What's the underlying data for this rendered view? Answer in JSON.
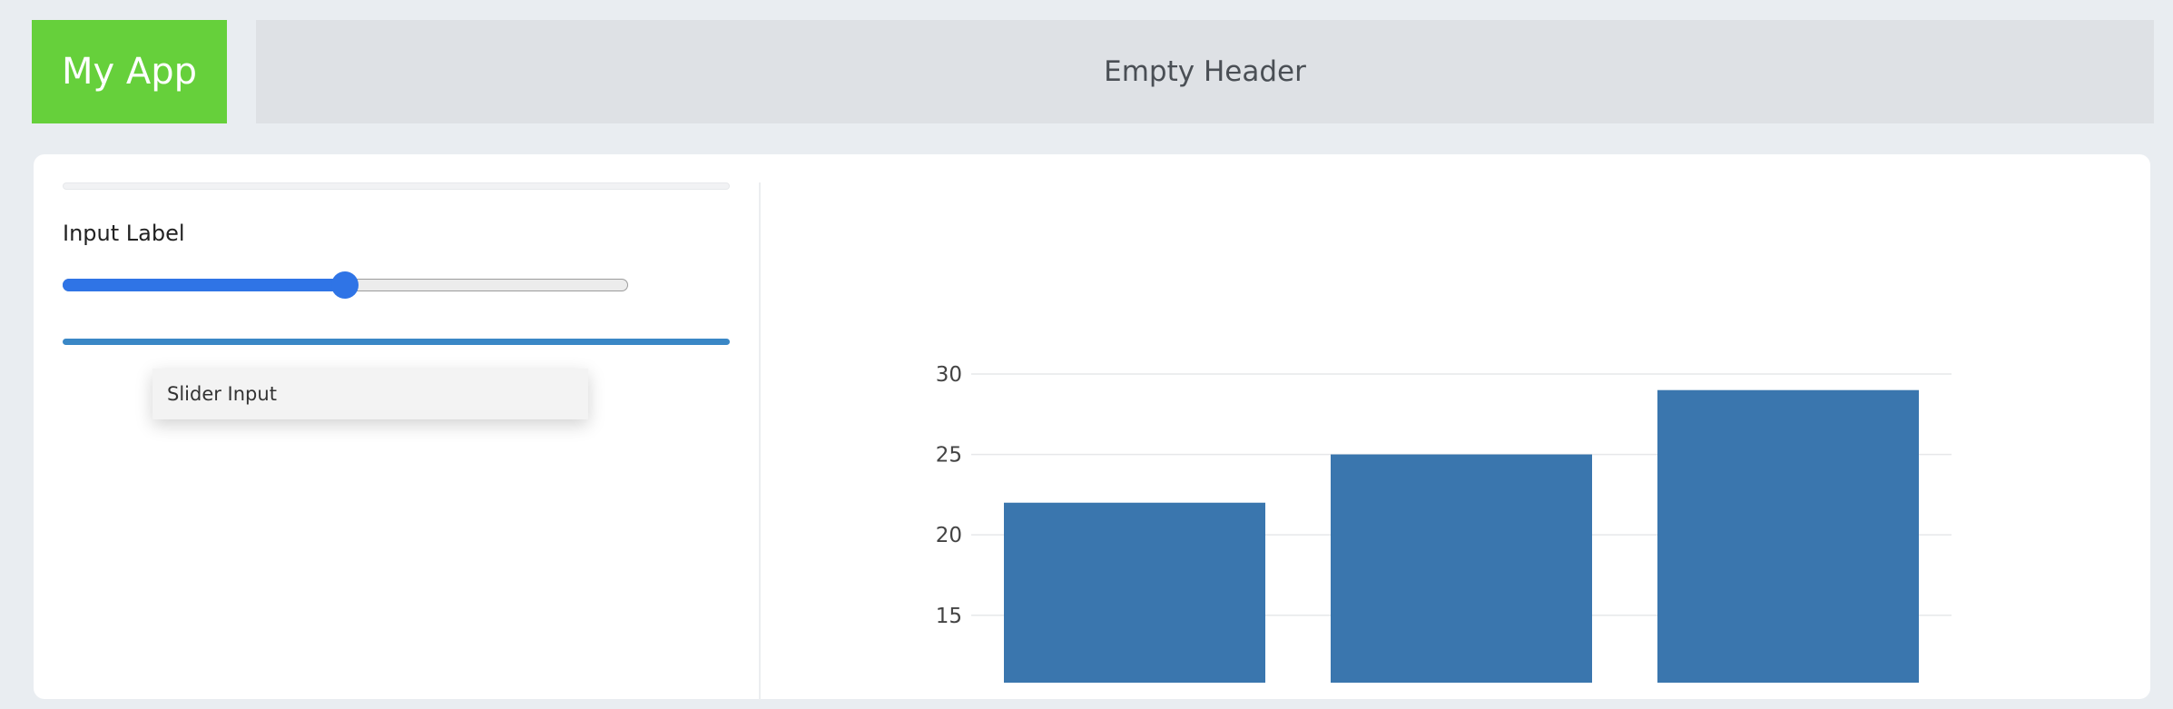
{
  "app": {
    "title": "My App"
  },
  "header": {
    "title": "Empty Header"
  },
  "controls": {
    "input_label": "Input Label",
    "slider_value_fraction": 0.5,
    "tooltip_text": "Slider Input"
  },
  "colors": {
    "logo_bg": "#66d03b",
    "bar": "#3a76ae",
    "slider_accent": "#2f74e6",
    "progress": "#3a87c6"
  },
  "chart_data": {
    "type": "bar",
    "categories": [
      "",
      "",
      ""
    ],
    "values": [
      22,
      25,
      29
    ],
    "yticks": [
      15,
      20,
      25,
      30
    ],
    "ylim": [
      10.5,
      31.5
    ],
    "title": "",
    "xlabel": "",
    "ylabel": "",
    "grid": true
  }
}
